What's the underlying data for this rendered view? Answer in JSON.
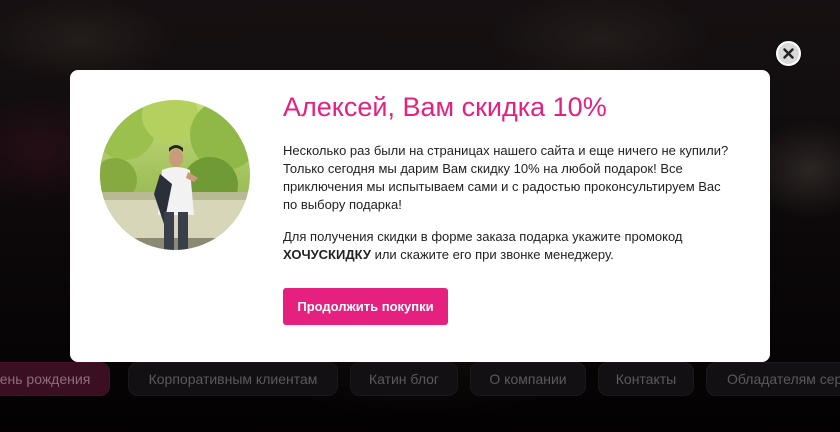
{
  "popup": {
    "title": "Алексей, Вам скидка 10%",
    "paragraph1": "Несколько раз были на страницах нашего сайта и еще ничего не купили? Только сегодня мы дарим Вам скидку 10% на любой подарок! Все приключения мы испытываем сами и с радостью проконсультируем Вас по выбору подарка!",
    "paragraph2_before": "Для получения скидки в форме заказа подарка укажите промокод ",
    "promo_code": "ХОЧУСКИДКУ",
    "paragraph2_after": " или скажите его при звонке менеджеру.",
    "cta_label": "Продолжить покупки",
    "close_icon": "close-icon",
    "accent_color": "#e5207f"
  },
  "nav": {
    "items": [
      {
        "label": "ень рождения",
        "active": true
      },
      {
        "label": "Корпоративным клиентам",
        "active": false
      },
      {
        "label": "Катин блог",
        "active": false
      },
      {
        "label": "О компании",
        "active": false
      },
      {
        "label": "Контакты",
        "active": false
      },
      {
        "label": "Обладателям серт",
        "active": false
      }
    ]
  }
}
